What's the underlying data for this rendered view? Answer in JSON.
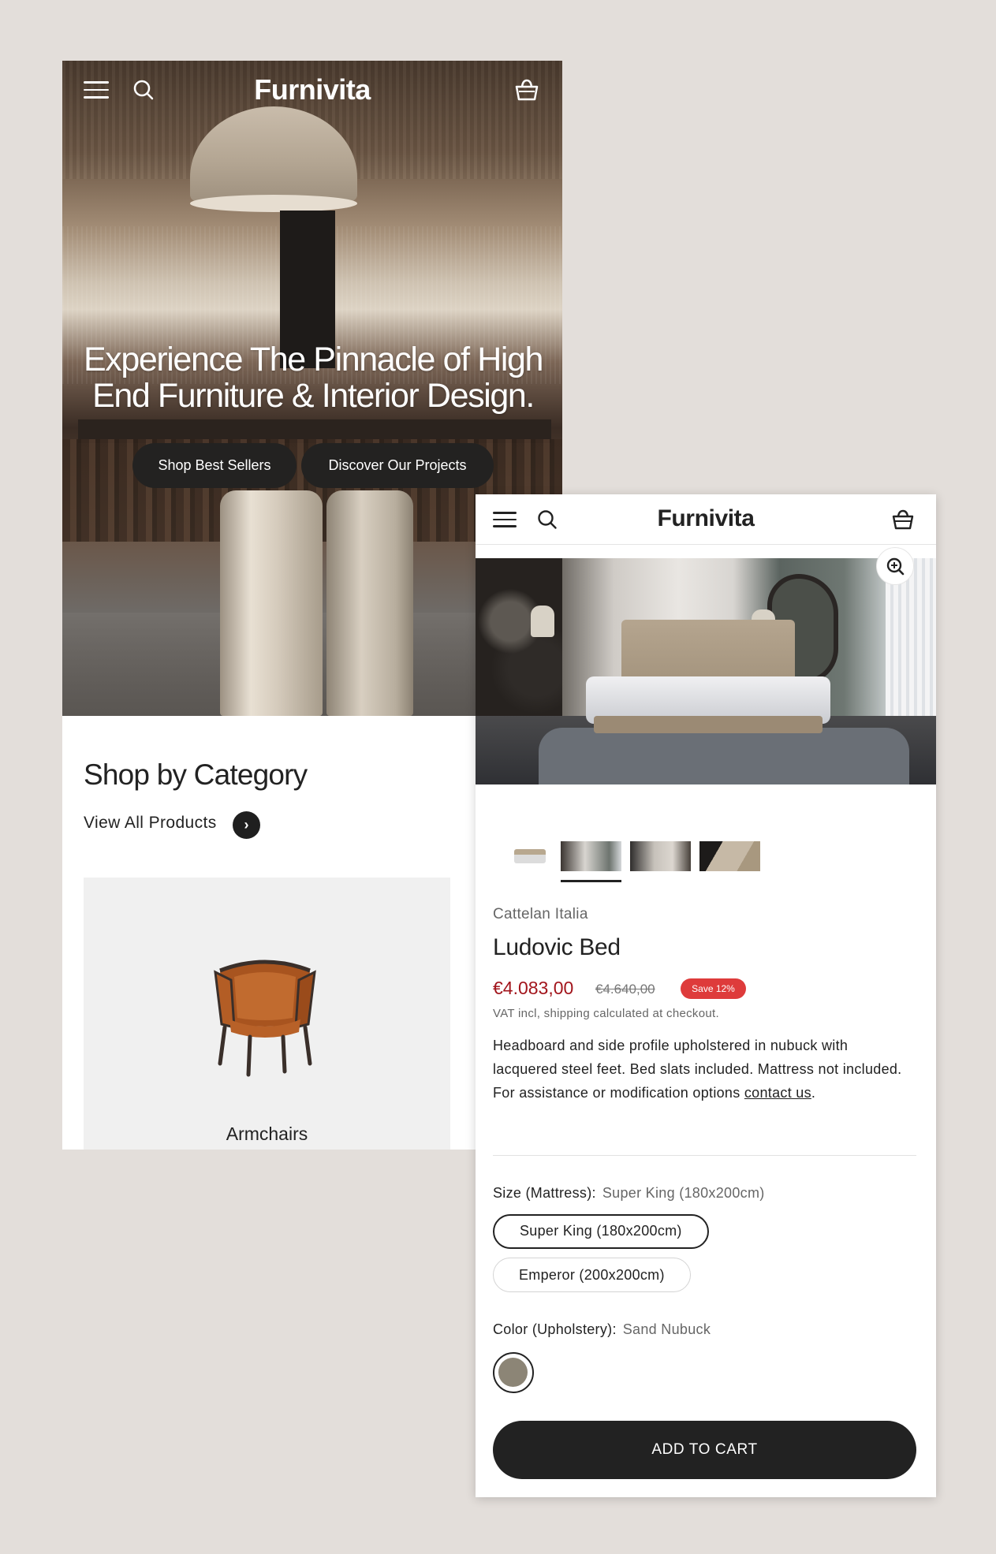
{
  "colors": {
    "background": "#e3deda",
    "accent_dark": "#222222",
    "price_red": "#a2151c",
    "save_badge": "#de3b3b",
    "swatch_sand_nubuck": "#8c8576"
  },
  "home_screen": {
    "header": {
      "menu_icon": "hamburger-icon",
      "search_icon": "search-icon",
      "logo": "Furnivita",
      "cart_icon": "basket-icon"
    },
    "hero": {
      "headline": "Experience The Pinnacle of High End Furniture & Interior Design.",
      "primary_button": "Shop Best Sellers",
      "secondary_button": "Discover Our Projects"
    },
    "category_section": {
      "title": "Shop by Category",
      "view_all_label": "View All Products",
      "view_all_icon": "chevron-right-icon",
      "cards": [
        {
          "label": "Armchairs"
        }
      ]
    }
  },
  "product_screen": {
    "header": {
      "menu_icon": "hamburger-icon",
      "search_icon": "search-icon",
      "logo": "Furnivita",
      "cart_icon": "basket-icon"
    },
    "zoom_icon": "zoom-in-icon",
    "thumbnails_count": 4,
    "selected_thumbnail": 2,
    "brand": "Cattelan Italia",
    "name": "Ludovic Bed",
    "price": "€4.083,00",
    "compare_price": "€4.640,00",
    "save_badge": "Save 12%",
    "vat_note": "VAT incl, shipping calculated at checkout.",
    "description_text": "Headboard and side profile upholstered in nubuck with lacquered steel feet. Bed slats included. Mattress not included. For assistance or modification options",
    "description_link": "contact us",
    "description_end": ".",
    "size_option": {
      "label": "Size (Mattress):",
      "selected": "Super King (180x200cm)",
      "values": [
        "Super King (180x200cm)",
        "Emperor (200x200cm)"
      ]
    },
    "color_option": {
      "label": "Color (Upholstery):",
      "selected": "Sand Nubuck"
    },
    "add_to_cart": "ADD TO CART"
  }
}
